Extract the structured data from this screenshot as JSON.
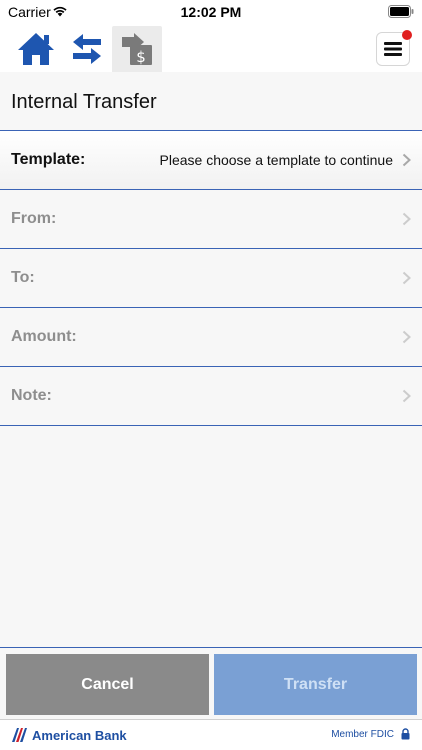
{
  "status_bar": {
    "carrier": "Carrier",
    "time": "12:02 PM",
    "icons": [
      "wifi-icon",
      "battery-icon"
    ]
  },
  "toolbar": {
    "icons": [
      "home-icon",
      "transfers-icon",
      "internal-transfer-icon",
      "menu-icon"
    ],
    "notification": true
  },
  "page": {
    "title": "Internal Transfer"
  },
  "form": {
    "rows": [
      {
        "label": "Template:",
        "value": "Please choose a template to continue",
        "active": true
      },
      {
        "label": "From:",
        "value": "",
        "active": false
      },
      {
        "label": "To:",
        "value": "",
        "active": false
      },
      {
        "label": "Amount:",
        "value": "",
        "active": false
      },
      {
        "label": "Note:",
        "value": "",
        "active": false
      }
    ]
  },
  "buttons": {
    "cancel": "Cancel",
    "transfer": "Transfer"
  },
  "footer": {
    "brand": "American Bank",
    "fdic": "Member FDIC"
  },
  "colors": {
    "accent": "#1e4fa2",
    "divider": "#3a63b5",
    "cancel_bg": "#8a8a8a",
    "transfer_bg": "#7aa0d4",
    "notification": "#e02020"
  }
}
